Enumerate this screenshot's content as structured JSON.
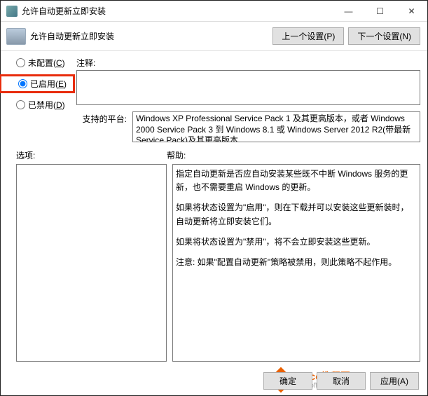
{
  "window": {
    "title": "允许自动更新立即安装"
  },
  "header": {
    "title": "允许自动更新立即安装",
    "prev_label": "上一个设置(P)",
    "next_label": "下一个设置(N)"
  },
  "radios": {
    "not_configured": "未配置(",
    "not_configured_key": "C",
    "enabled": "已启用(",
    "enabled_key": "E",
    "disabled": "已禁用(",
    "disabled_key": "D",
    "close_paren": ")"
  },
  "labels": {
    "comment": "注释:",
    "supported_on": "支持的平台:",
    "options": "选项:",
    "help": "帮助:"
  },
  "platform_text": "Windows XP Professional Service Pack 1 及其更高版本，或者 Windows 2000 Service Pack 3 到 Windows 8.1 或 Windows Server 2012 R2(带最新 Service Pack)及其更高版本",
  "help": {
    "p1": "指定自动更新是否应自动安装某些既不中断 Windows 服务的更新，也不需要重启 Windows 的更新。",
    "p2": "如果将状态设置为\"启用\"，则在下载并可以安装这些更新装时，自动更新将立即安装它们。",
    "p3": "如果将状态设置为\"禁用\"，将不会立即安装这些更新。",
    "p4": "注意: 如果\"配置自动更新\"策略被禁用，则此策略不起作用。"
  },
  "footer": {
    "ok": "确定",
    "cancel": "取消",
    "apply": "应用(A)"
  },
  "watermark": {
    "text": "Office教程网",
    "sub": "www.office26.com"
  }
}
